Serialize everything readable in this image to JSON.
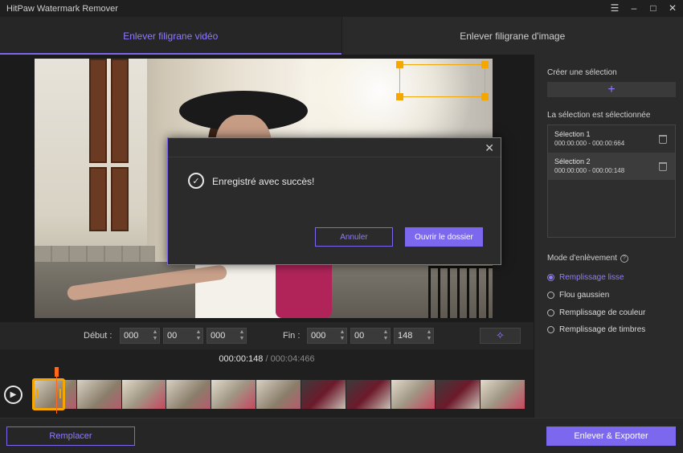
{
  "window": {
    "title": "HitPaw Watermark Remover",
    "controls": [
      "minimize",
      "maximize",
      "close"
    ]
  },
  "tabs": [
    {
      "label": "Enlever filigrane vidéo",
      "active": true
    },
    {
      "label": "Enlever filigrane d'image",
      "active": false
    }
  ],
  "time_fields": {
    "start_label": "Début :",
    "start": [
      "000",
      "00",
      "000"
    ],
    "end_label": "Fin :",
    "end": [
      "000",
      "00",
      "148"
    ]
  },
  "timeline": {
    "current": "000:00:148",
    "separator": " / ",
    "total": "000:04:466"
  },
  "bottom": {
    "replace_label": "Remplacer",
    "export_label": "Enlever & Exporter"
  },
  "sidebar": {
    "create_label": "Créer une sélection",
    "selected_label": "La sélection est sélectionnée",
    "selections": [
      {
        "name": "Sélection 1",
        "range": "000:00:000 - 000:00:664",
        "active": false
      },
      {
        "name": "Sélection 2",
        "range": "000:00:000 - 000:00:148",
        "active": true
      }
    ],
    "mode_label": "Mode d'enlèvement",
    "modes": [
      {
        "label": "Remplissage lisse",
        "checked": true
      },
      {
        "label": "Flou gaussien",
        "checked": false
      },
      {
        "label": "Remplissage de couleur",
        "checked": false
      },
      {
        "label": "Remplissage de timbres",
        "checked": false
      }
    ]
  },
  "dialog": {
    "message": "Enregistré avec succès!",
    "cancel_label": "Annuler",
    "open_label": "Ouvrir le dossier"
  },
  "colors": {
    "accent": "#7b68ee",
    "selection_handle": "#f5a700",
    "playhead": "#ff6a1a"
  }
}
